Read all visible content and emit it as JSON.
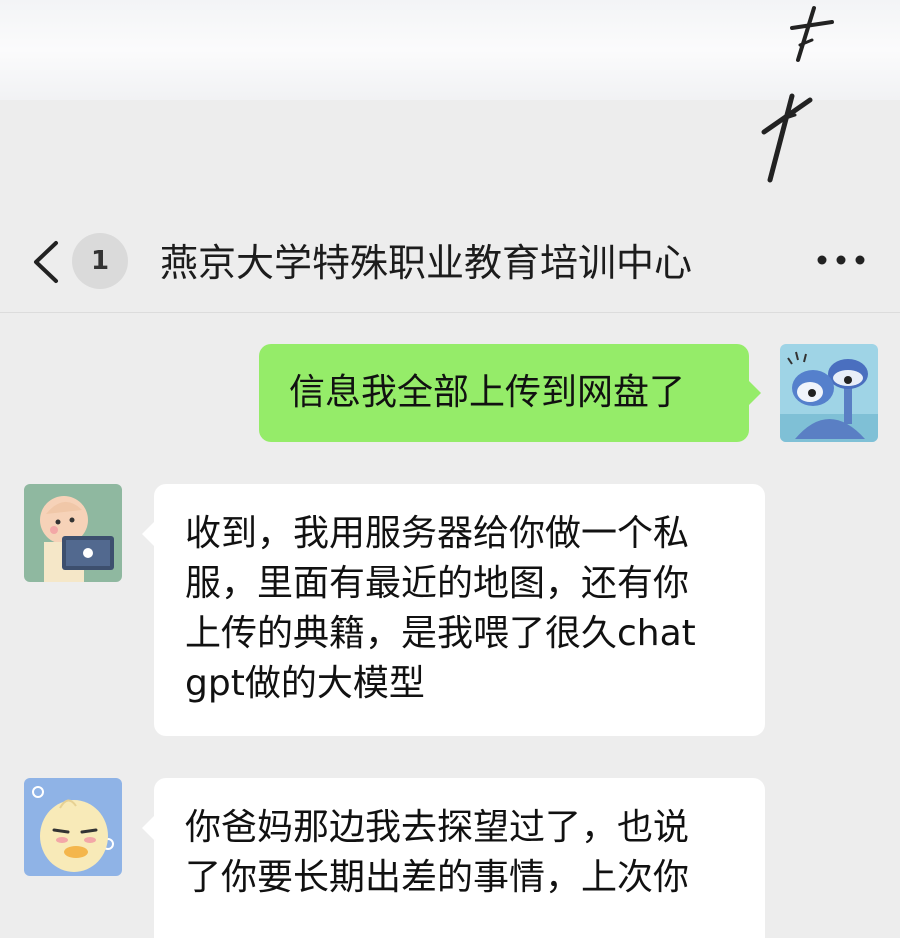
{
  "header": {
    "back_icon": "chevron-left-icon",
    "unread_count": "1",
    "title": "燕京大学特殊职业教育培训中心",
    "more_icon": "more-dots-icon"
  },
  "messages": [
    {
      "sender": "me",
      "avatar": "mushroom-avatar",
      "text": "信息我全部上传到网盘了"
    },
    {
      "sender": "contact",
      "avatar": "baby-laptop-avatar",
      "lines": [
        "收到，我用服务器给你做一个私",
        "服，里面有最近的地图，还有你",
        "上传的典籍，是我喂了很久chat",
        "gpt做的大模型"
      ]
    },
    {
      "sender": "contact",
      "avatar": "duck-avatar",
      "lines": [
        "你爸妈那边我去探望过了，也说",
        "了你要长期出差的事情，上次你"
      ]
    }
  ],
  "colors": {
    "my_bubble": "#95ec69",
    "their_bubble": "#ffffff",
    "background": "#ededed"
  }
}
